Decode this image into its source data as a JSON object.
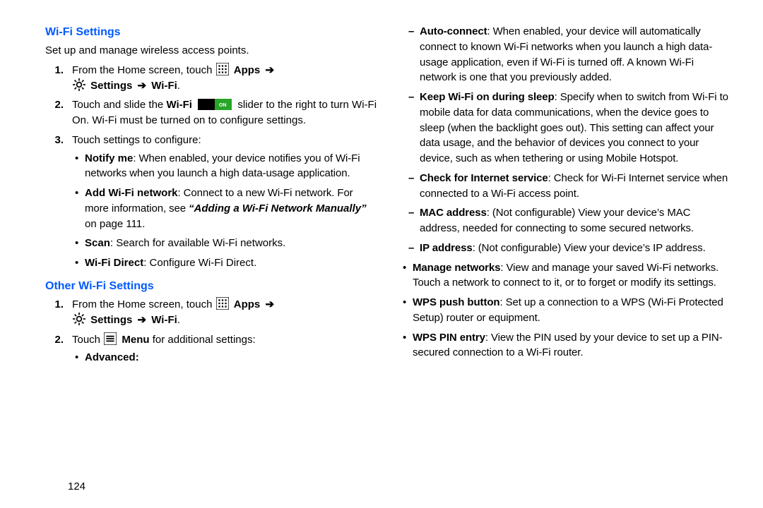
{
  "page_number": "124",
  "left": {
    "h_wifi": "Wi-Fi Settings",
    "intro": "Set up and manage wireless access points.",
    "s1a": "From the Home screen, touch ",
    "apps": "Apps",
    "settings": "Settings",
    "wifi": "Wi-Fi",
    "s2a": "Touch and slide the ",
    "s2label": "Wi-Fi",
    "s2b": " slider to the right to turn Wi-Fi On. Wi-Fi must be turned on to configure settings.",
    "s3": "Touch settings to configure:",
    "b_notify_t": "Notify me",
    "b_notify": ": When enabled, your device notifies you of Wi-Fi networks when you launch a high data-usage application.",
    "b_add_t": "Add Wi-Fi network",
    "b_add_a": ": Connect to a new Wi-Fi network. For more information, see ",
    "b_add_link": "“Adding a Wi-Fi Network Manually”",
    "b_add_b": " on page 111.",
    "b_scan_t": "Scan",
    "b_scan": ": Search for available Wi-Fi networks.",
    "b_direct_t": "Wi-Fi Direct",
    "b_direct": ": Configure Wi-Fi Direct.",
    "h_other": "Other Wi-Fi Settings",
    "o1": "From the Home screen, touch ",
    "o2a": "Touch ",
    "o2menu": "Menu",
    "o2b": " for additional settings:",
    "o_adv": "Advanced",
    "colon": ":"
  },
  "right": {
    "d_auto_t": "Auto-connect",
    "d_auto": ": When enabled, your device will automatically connect to known Wi-Fi networks when you launch a high data-usage application, even if Wi-Fi is turned off. A known Wi-Fi network is one that you previously added.",
    "d_sleep_t": "Keep Wi-Fi on during sleep",
    "d_sleep": ": Specify when to switch from Wi-Fi to mobile data for data communications, when the device goes to sleep (when the backlight goes out). This setting can affect your data usage, and the behavior of devices you connect to your device, such as when tethering or using Mobile Hotspot.",
    "d_check_t": "Check for Internet service",
    "d_check": ": Check for Wi-Fi Internet service when connected to a Wi-Fi access point.",
    "d_mac_t": "MAC address",
    "d_mac": ": (Not configurable) View your device’s MAC address, needed for connecting to some secured networks.",
    "d_ip_t": "IP address",
    "d_ip": ": (Not configurable) View your device’s IP address.",
    "t_mng_t": "Manage networks",
    "t_mng": ": View and manage your saved Wi-Fi networks. Touch a network to connect to it, or to forget or modify its settings.",
    "t_wpsb_t": "WPS push button",
    "t_wpsb": ": Set up a connection to a WPS (Wi-Fi Protected Setup) router or equipment.",
    "t_wpsp_t": "WPS PIN entry",
    "t_wpsp": ": View the PIN used by your device to set up a PIN-secured connection to a Wi-Fi router."
  }
}
